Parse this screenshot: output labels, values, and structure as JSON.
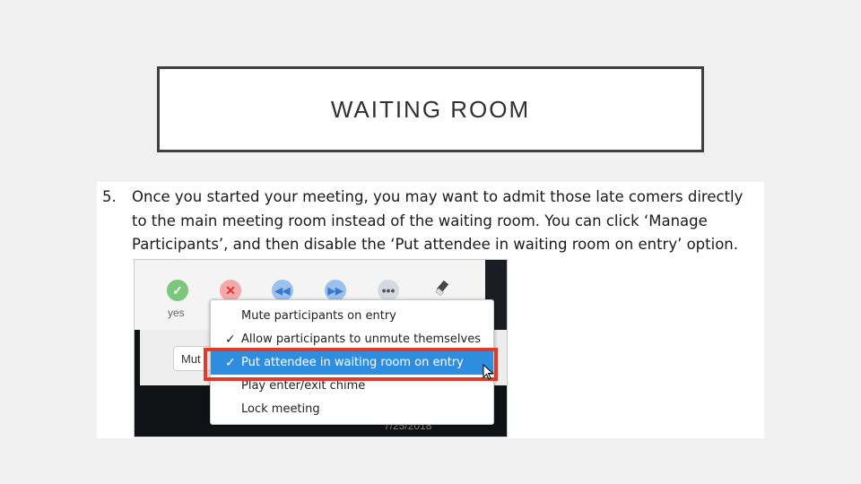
{
  "slide": {
    "title": "WAITING ROOM"
  },
  "step": {
    "number": "5.",
    "text": "Once you started your meeting, you may want to admit those late comers directly to the main meeting room instead of the waiting room. You can click ‘Manage Participants’, and then disable the ‘Put attendee in waiting room on entry’ option."
  },
  "screenshot": {
    "yes_label": "yes",
    "mute_button_label": "Mut",
    "date_text": "7/25/2018",
    "icons": [
      "check-icon",
      "x-icon",
      "rewind-icon",
      "forward-icon",
      "more-icon",
      "eraser-icon"
    ],
    "menu": {
      "items": [
        {
          "label": "Mute participants on entry",
          "checked": false
        },
        {
          "label": "Allow participants to unmute themselves",
          "checked": true
        },
        {
          "label": "Put attendee in waiting room on entry",
          "checked": true,
          "highlighted": true
        },
        {
          "label": "Play enter/exit chime",
          "checked": false
        },
        {
          "label": "Lock meeting",
          "checked": false
        }
      ],
      "check_glyph": "✓"
    },
    "colors": {
      "highlight_outline": "#e23a2a",
      "selected_row": "#2f8ddf"
    }
  }
}
